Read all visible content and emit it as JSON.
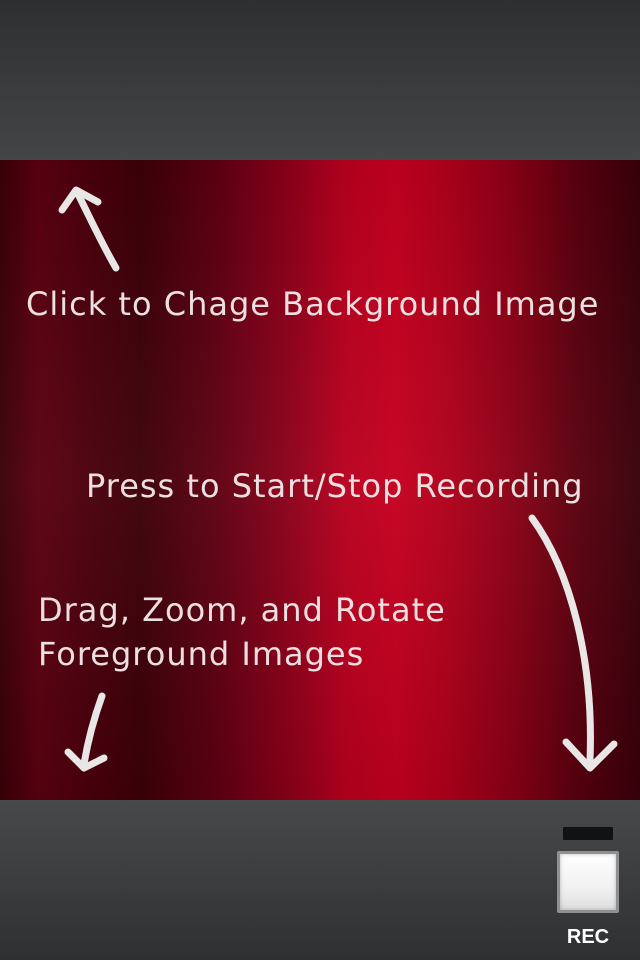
{
  "hints": {
    "background": "Click to Chage Background Image",
    "record": "Press to Start/Stop Recording",
    "foreground": "Drag, Zoom, and Rotate\nForeground Images"
  },
  "toolbar": {
    "rec_label": "REC"
  },
  "colors": {
    "bar_dark": "#2e2f31",
    "canvas_red": "#c4001f",
    "canvas_dark": "#3a0008",
    "hint_text": "#ecdfe0"
  },
  "icons": {
    "arrow_up": "arrow-up-icon",
    "arrow_down_long": "arrow-down-icon",
    "arrow_down_short": "arrow-down-icon"
  }
}
